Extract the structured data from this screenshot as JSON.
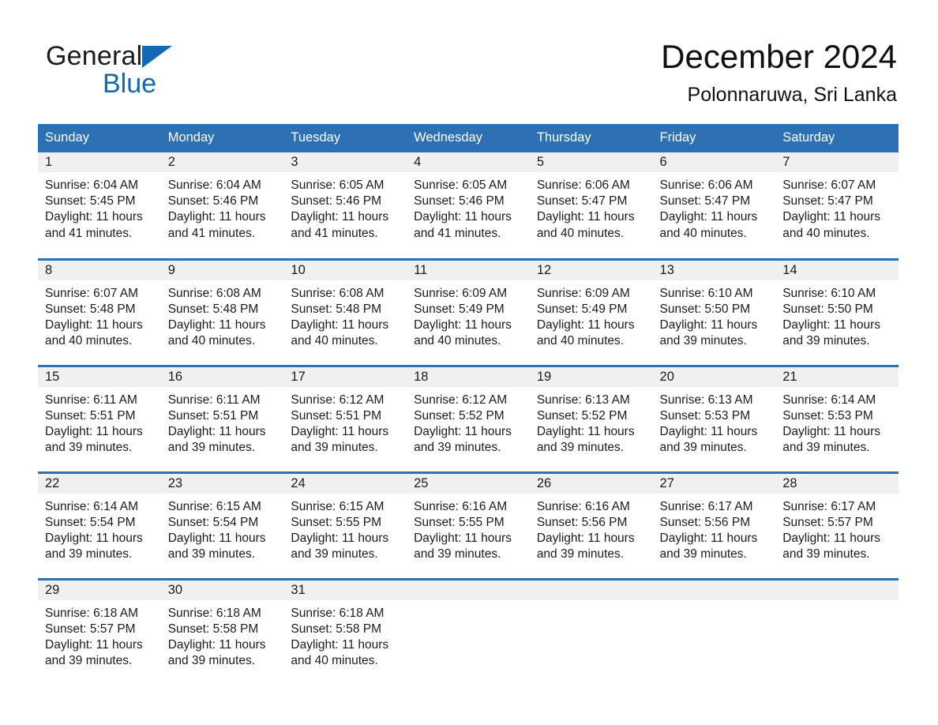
{
  "brand": {
    "word_general": "General",
    "word_blue": "Blue",
    "triangle_color": "#1268b3",
    "icon": "general-blue-logo-triangle"
  },
  "header": {
    "month_title": "December 2024",
    "location": "Polonnaruwa, Sri Lanka",
    "accent_color": "#2e70b4",
    "daynum_band_color": "#f0f0f0"
  },
  "calendar": {
    "weekday_headers": [
      "Sunday",
      "Monday",
      "Tuesday",
      "Wednesday",
      "Thursday",
      "Friday",
      "Saturday"
    ],
    "weeks": [
      [
        {
          "day": "1",
          "sunrise": "Sunrise: 6:04 AM",
          "sunset": "Sunset: 5:45 PM",
          "daylight_line1": "Daylight: 11 hours",
          "daylight_line2": "and 41 minutes."
        },
        {
          "day": "2",
          "sunrise": "Sunrise: 6:04 AM",
          "sunset": "Sunset: 5:46 PM",
          "daylight_line1": "Daylight: 11 hours",
          "daylight_line2": "and 41 minutes."
        },
        {
          "day": "3",
          "sunrise": "Sunrise: 6:05 AM",
          "sunset": "Sunset: 5:46 PM",
          "daylight_line1": "Daylight: 11 hours",
          "daylight_line2": "and 41 minutes."
        },
        {
          "day": "4",
          "sunrise": "Sunrise: 6:05 AM",
          "sunset": "Sunset: 5:46 PM",
          "daylight_line1": "Daylight: 11 hours",
          "daylight_line2": "and 41 minutes."
        },
        {
          "day": "5",
          "sunrise": "Sunrise: 6:06 AM",
          "sunset": "Sunset: 5:47 PM",
          "daylight_line1": "Daylight: 11 hours",
          "daylight_line2": "and 40 minutes."
        },
        {
          "day": "6",
          "sunrise": "Sunrise: 6:06 AM",
          "sunset": "Sunset: 5:47 PM",
          "daylight_line1": "Daylight: 11 hours",
          "daylight_line2": "and 40 minutes."
        },
        {
          "day": "7",
          "sunrise": "Sunrise: 6:07 AM",
          "sunset": "Sunset: 5:47 PM",
          "daylight_line1": "Daylight: 11 hours",
          "daylight_line2": "and 40 minutes."
        }
      ],
      [
        {
          "day": "8",
          "sunrise": "Sunrise: 6:07 AM",
          "sunset": "Sunset: 5:48 PM",
          "daylight_line1": "Daylight: 11 hours",
          "daylight_line2": "and 40 minutes."
        },
        {
          "day": "9",
          "sunrise": "Sunrise: 6:08 AM",
          "sunset": "Sunset: 5:48 PM",
          "daylight_line1": "Daylight: 11 hours",
          "daylight_line2": "and 40 minutes."
        },
        {
          "day": "10",
          "sunrise": "Sunrise: 6:08 AM",
          "sunset": "Sunset: 5:48 PM",
          "daylight_line1": "Daylight: 11 hours",
          "daylight_line2": "and 40 minutes."
        },
        {
          "day": "11",
          "sunrise": "Sunrise: 6:09 AM",
          "sunset": "Sunset: 5:49 PM",
          "daylight_line1": "Daylight: 11 hours",
          "daylight_line2": "and 40 minutes."
        },
        {
          "day": "12",
          "sunrise": "Sunrise: 6:09 AM",
          "sunset": "Sunset: 5:49 PM",
          "daylight_line1": "Daylight: 11 hours",
          "daylight_line2": "and 40 minutes."
        },
        {
          "day": "13",
          "sunrise": "Sunrise: 6:10 AM",
          "sunset": "Sunset: 5:50 PM",
          "daylight_line1": "Daylight: 11 hours",
          "daylight_line2": "and 39 minutes."
        },
        {
          "day": "14",
          "sunrise": "Sunrise: 6:10 AM",
          "sunset": "Sunset: 5:50 PM",
          "daylight_line1": "Daylight: 11 hours",
          "daylight_line2": "and 39 minutes."
        }
      ],
      [
        {
          "day": "15",
          "sunrise": "Sunrise: 6:11 AM",
          "sunset": "Sunset: 5:51 PM",
          "daylight_line1": "Daylight: 11 hours",
          "daylight_line2": "and 39 minutes."
        },
        {
          "day": "16",
          "sunrise": "Sunrise: 6:11 AM",
          "sunset": "Sunset: 5:51 PM",
          "daylight_line1": "Daylight: 11 hours",
          "daylight_line2": "and 39 minutes."
        },
        {
          "day": "17",
          "sunrise": "Sunrise: 6:12 AM",
          "sunset": "Sunset: 5:51 PM",
          "daylight_line1": "Daylight: 11 hours",
          "daylight_line2": "and 39 minutes."
        },
        {
          "day": "18",
          "sunrise": "Sunrise: 6:12 AM",
          "sunset": "Sunset: 5:52 PM",
          "daylight_line1": "Daylight: 11 hours",
          "daylight_line2": "and 39 minutes."
        },
        {
          "day": "19",
          "sunrise": "Sunrise: 6:13 AM",
          "sunset": "Sunset: 5:52 PM",
          "daylight_line1": "Daylight: 11 hours",
          "daylight_line2": "and 39 minutes."
        },
        {
          "day": "20",
          "sunrise": "Sunrise: 6:13 AM",
          "sunset": "Sunset: 5:53 PM",
          "daylight_line1": "Daylight: 11 hours",
          "daylight_line2": "and 39 minutes."
        },
        {
          "day": "21",
          "sunrise": "Sunrise: 6:14 AM",
          "sunset": "Sunset: 5:53 PM",
          "daylight_line1": "Daylight: 11 hours",
          "daylight_line2": "and 39 minutes."
        }
      ],
      [
        {
          "day": "22",
          "sunrise": "Sunrise: 6:14 AM",
          "sunset": "Sunset: 5:54 PM",
          "daylight_line1": "Daylight: 11 hours",
          "daylight_line2": "and 39 minutes."
        },
        {
          "day": "23",
          "sunrise": "Sunrise: 6:15 AM",
          "sunset": "Sunset: 5:54 PM",
          "daylight_line1": "Daylight: 11 hours",
          "daylight_line2": "and 39 minutes."
        },
        {
          "day": "24",
          "sunrise": "Sunrise: 6:15 AM",
          "sunset": "Sunset: 5:55 PM",
          "daylight_line1": "Daylight: 11 hours",
          "daylight_line2": "and 39 minutes."
        },
        {
          "day": "25",
          "sunrise": "Sunrise: 6:16 AM",
          "sunset": "Sunset: 5:55 PM",
          "daylight_line1": "Daylight: 11 hours",
          "daylight_line2": "and 39 minutes."
        },
        {
          "day": "26",
          "sunrise": "Sunrise: 6:16 AM",
          "sunset": "Sunset: 5:56 PM",
          "daylight_line1": "Daylight: 11 hours",
          "daylight_line2": "and 39 minutes."
        },
        {
          "day": "27",
          "sunrise": "Sunrise: 6:17 AM",
          "sunset": "Sunset: 5:56 PM",
          "daylight_line1": "Daylight: 11 hours",
          "daylight_line2": "and 39 minutes."
        },
        {
          "day": "28",
          "sunrise": "Sunrise: 6:17 AM",
          "sunset": "Sunset: 5:57 PM",
          "daylight_line1": "Daylight: 11 hours",
          "daylight_line2": "and 39 minutes."
        }
      ],
      [
        {
          "day": "29",
          "sunrise": "Sunrise: 6:18 AM",
          "sunset": "Sunset: 5:57 PM",
          "daylight_line1": "Daylight: 11 hours",
          "daylight_line2": "and 39 minutes."
        },
        {
          "day": "30",
          "sunrise": "Sunrise: 6:18 AM",
          "sunset": "Sunset: 5:58 PM",
          "daylight_line1": "Daylight: 11 hours",
          "daylight_line2": "and 39 minutes."
        },
        {
          "day": "31",
          "sunrise": "Sunrise: 6:18 AM",
          "sunset": "Sunset: 5:58 PM",
          "daylight_line1": "Daylight: 11 hours",
          "daylight_line2": "and 40 minutes."
        },
        {
          "day": "",
          "sunrise": "",
          "sunset": "",
          "daylight_line1": "",
          "daylight_line2": ""
        },
        {
          "day": "",
          "sunrise": "",
          "sunset": "",
          "daylight_line1": "",
          "daylight_line2": ""
        },
        {
          "day": "",
          "sunrise": "",
          "sunset": "",
          "daylight_line1": "",
          "daylight_line2": ""
        },
        {
          "day": "",
          "sunrise": "",
          "sunset": "",
          "daylight_line1": "",
          "daylight_line2": ""
        }
      ]
    ]
  }
}
